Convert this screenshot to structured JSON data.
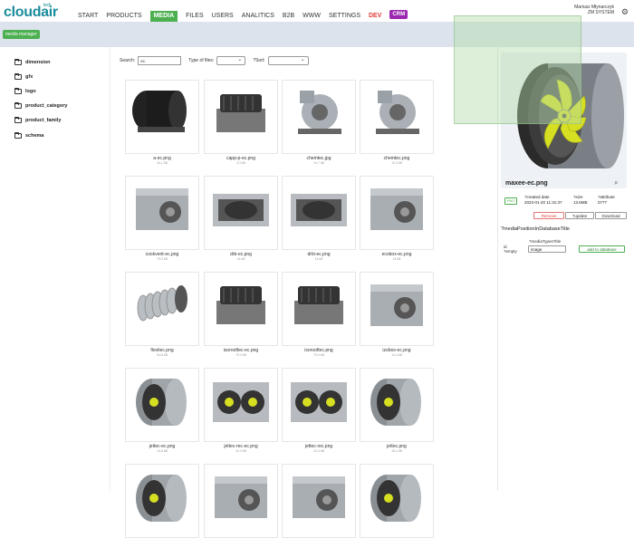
{
  "app": {
    "logo_main": "cloudair",
    "logo_sub": "tech"
  },
  "nav": [
    {
      "label": "START",
      "style": ""
    },
    {
      "label": "PRODUCTS",
      "style": ""
    },
    {
      "label": "MEDIA",
      "style": "active"
    },
    {
      "label": "FILES",
      "style": ""
    },
    {
      "label": "USERS",
      "style": ""
    },
    {
      "label": "ANALITICS",
      "style": ""
    },
    {
      "label": "B2B",
      "style": ""
    },
    {
      "label": "WWW",
      "style": ""
    },
    {
      "label": "SETTINGS",
      "style": ""
    },
    {
      "label": "DEV",
      "style": "red"
    },
    {
      "label": "CRM",
      "style": "crm"
    }
  ],
  "user": {
    "name": "Mariusz Młynarczyk",
    "company": "ZM SYSTEM"
  },
  "badge": "media manager",
  "folders": [
    "dimension",
    "gfx",
    "logo",
    "product_category",
    "product_family",
    "schema"
  ],
  "filters": {
    "search_label": "Search:",
    "search_value": "ec.",
    "type_label": "Type of files:",
    "sort_label": "?Sort:"
  },
  "files": [
    {
      "name": "a-ec.png",
      "size": "34.1 kB",
      "icon": "centrifugal-tube-fan-icon"
    },
    {
      "name": "capp-p-ec.png",
      "size": "3.3 kB",
      "icon": "roof-fan-icon"
    },
    {
      "name": "chemtec.jpg",
      "size": "14.7 kB",
      "icon": "centrifugal-blower-icon"
    },
    {
      "name": "chemtec.png",
      "size": "12.3 kB",
      "icon": "centrifugal-blower-icon"
    },
    {
      "name": "cookvent-ec.png",
      "size": "73.3 kB",
      "icon": "box-fan-icon"
    },
    {
      "name": "drb-ec.png",
      "size": "14 kB",
      "icon": "rectangular-duct-fan-icon"
    },
    {
      "name": "drbi-ec.png",
      "size": "14 kB",
      "icon": "rectangular-duct-fan-icon"
    },
    {
      "name": "ecobox-ec.png",
      "size": "14 kB",
      "icon": "box-fan-icon"
    },
    {
      "name": "flexitec.png",
      "size": "54.8 kB",
      "icon": "flexible-duct-icon"
    },
    {
      "name": "isorooftec-ec.png",
      "size": "73.4 kB",
      "icon": "roof-fan-icon"
    },
    {
      "name": "isorooftec.png",
      "size": "73.4 kB",
      "icon": "roof-fan-icon"
    },
    {
      "name": "izobox-ec.png",
      "size": "14.4 kB",
      "icon": "box-fan-icon"
    },
    {
      "name": "jettec-ec.png",
      "size": "14.6 kB",
      "icon": "axial-fan-icon"
    },
    {
      "name": "jettec-rec-ec.png",
      "size": "14.4 kB",
      "icon": "twin-axial-fan-icon"
    },
    {
      "name": "jettec-rec.png",
      "size": "13.4 kB",
      "icon": "twin-axial-fan-icon"
    },
    {
      "name": "jettec.png",
      "size": "18.4 kB",
      "icon": "axial-fan-icon"
    },
    {
      "name": "",
      "size": "",
      "icon": "axial-fan-icon"
    },
    {
      "name": "",
      "size": "",
      "icon": "box-fan-icon"
    },
    {
      "name": "",
      "size": "",
      "icon": "box-fan-icon"
    },
    {
      "name": "",
      "size": "",
      "icon": "axial-fan-icon"
    }
  ],
  "preview": {
    "title": "maxee-ec.png",
    "type_badge": "PNG",
    "created_label": "?created date",
    "created_value": "2023-01-20 11:31:37",
    "size_label": "?size",
    "size_value": "13.6MB",
    "attr_label": "?attribute",
    "attr_value": "0777",
    "remove": "Remove",
    "update": "?update",
    "download": "Download",
    "db_title": "?mediaPositionInDatabaseTitle",
    "id_label": "id",
    "id_value": "?empty",
    "type_title": "?mediaTypesTitle",
    "type_value": "image",
    "add": "add to database"
  },
  "colors": {
    "accent": "#4caf50",
    "brand": "#1a8c9c",
    "dev": "#e53935",
    "crm": "#9c27b0"
  }
}
